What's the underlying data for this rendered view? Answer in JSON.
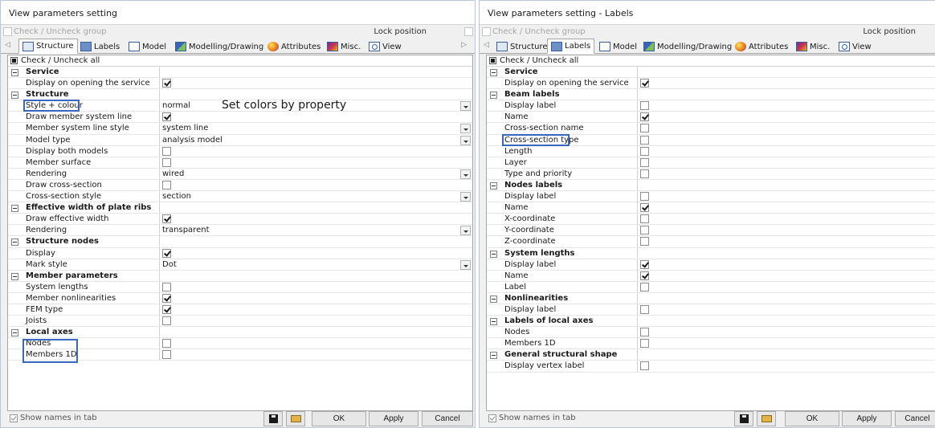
{
  "left": {
    "title": "View parameters setting",
    "check_group": "Check / Uncheck group",
    "lock_position": "Lock position",
    "tabs": [
      "Structure",
      "Labels",
      "Model",
      "Modelling/Drawing",
      "Attributes",
      "Misc.",
      "View"
    ],
    "check_all": "Check / Uncheck all",
    "annotation": "Set colors by property",
    "rows": [
      {
        "type": "section",
        "label": "Service"
      },
      {
        "type": "check",
        "label": "Display on opening the service",
        "checked": true
      },
      {
        "type": "section",
        "label": "Structure"
      },
      {
        "type": "value",
        "label": "Style + colour",
        "value": "normal",
        "dropdown": true,
        "highlight": true
      },
      {
        "type": "check",
        "label": "Draw member system line",
        "checked": true
      },
      {
        "type": "value",
        "label": "Member system line style",
        "value": "system line",
        "dropdown": true
      },
      {
        "type": "value",
        "label": "Model type",
        "value": "analysis model",
        "dropdown": true
      },
      {
        "type": "check",
        "label": "Display both models",
        "checked": false
      },
      {
        "type": "check",
        "label": "Member surface",
        "checked": false
      },
      {
        "type": "value",
        "label": "Rendering",
        "value": "wired",
        "dropdown": true
      },
      {
        "type": "check",
        "label": "Draw cross-section",
        "checked": false
      },
      {
        "type": "value",
        "label": "Cross-section style",
        "value": "section",
        "dropdown": true
      },
      {
        "type": "section",
        "label": "Effective width of plate ribs"
      },
      {
        "type": "check",
        "label": "Draw effective width",
        "checked": true
      },
      {
        "type": "value",
        "label": "Rendering",
        "value": "transparent",
        "dropdown": true
      },
      {
        "type": "section",
        "label": "Structure nodes"
      },
      {
        "type": "check",
        "label": "Display",
        "checked": true
      },
      {
        "type": "value",
        "label": "Mark style",
        "value": "Dot",
        "dropdown": true
      },
      {
        "type": "section",
        "label": "Member parameters"
      },
      {
        "type": "check",
        "label": "System lengths",
        "checked": false
      },
      {
        "type": "check",
        "label": "Member nonlinearities",
        "checked": true
      },
      {
        "type": "check",
        "label": "FEM type",
        "checked": true
      },
      {
        "type": "check",
        "label": "Joists",
        "checked": false
      },
      {
        "type": "section",
        "label": "Local axes"
      },
      {
        "type": "check",
        "label": "Nodes",
        "checked": false
      },
      {
        "type": "check",
        "label": "Members 1D",
        "checked": false
      }
    ],
    "show_names": "Show names in tab",
    "ok": "OK",
    "apply": "Apply",
    "cancel": "Cancel"
  },
  "right": {
    "title": "View parameters setting - Labels",
    "check_group": "Check / Uncheck group",
    "lock_position": "Lock position",
    "tabs": [
      "Structure",
      "Labels",
      "Model",
      "Modelling/Drawing",
      "Attributes",
      "Misc.",
      "View"
    ],
    "check_all": "Check / Uncheck all",
    "rows": [
      {
        "type": "section",
        "label": "Service"
      },
      {
        "type": "check",
        "label": "Display on opening the service",
        "checked": true
      },
      {
        "type": "section",
        "label": "Beam labels"
      },
      {
        "type": "check",
        "label": "Display label",
        "checked": false
      },
      {
        "type": "check",
        "label": "Name",
        "checked": true
      },
      {
        "type": "check",
        "label": "Cross-section name",
        "checked": false
      },
      {
        "type": "check",
        "label": "Cross-section type",
        "checked": false,
        "highlight": true
      },
      {
        "type": "check",
        "label": "Length",
        "checked": false
      },
      {
        "type": "check",
        "label": "Layer",
        "checked": false
      },
      {
        "type": "check",
        "label": "Type and priority",
        "checked": false
      },
      {
        "type": "section",
        "label": "Nodes labels"
      },
      {
        "type": "check",
        "label": "Display label",
        "checked": false
      },
      {
        "type": "check",
        "label": "Name",
        "checked": true
      },
      {
        "type": "check",
        "label": "X-coordinate",
        "checked": false
      },
      {
        "type": "check",
        "label": "Y-coordinate",
        "checked": false
      },
      {
        "type": "check",
        "label": "Z-coordinate",
        "checked": false
      },
      {
        "type": "section",
        "label": "System lengths"
      },
      {
        "type": "check",
        "label": "Display label",
        "checked": true
      },
      {
        "type": "check",
        "label": "Name",
        "checked": true
      },
      {
        "type": "check",
        "label": "Label",
        "checked": false
      },
      {
        "type": "section",
        "label": "Nonlinearities"
      },
      {
        "type": "check",
        "label": "Display label",
        "checked": false
      },
      {
        "type": "section",
        "label": "Labels of local axes"
      },
      {
        "type": "check",
        "label": "Nodes",
        "checked": false
      },
      {
        "type": "check",
        "label": "Members 1D",
        "checked": false
      },
      {
        "type": "section",
        "label": "General structural shape"
      },
      {
        "type": "check",
        "label": "Display vertex label",
        "checked": false
      }
    ],
    "show_names": "Show names in tab",
    "ok": "OK",
    "apply": "Apply",
    "cancel": "Cancel"
  }
}
